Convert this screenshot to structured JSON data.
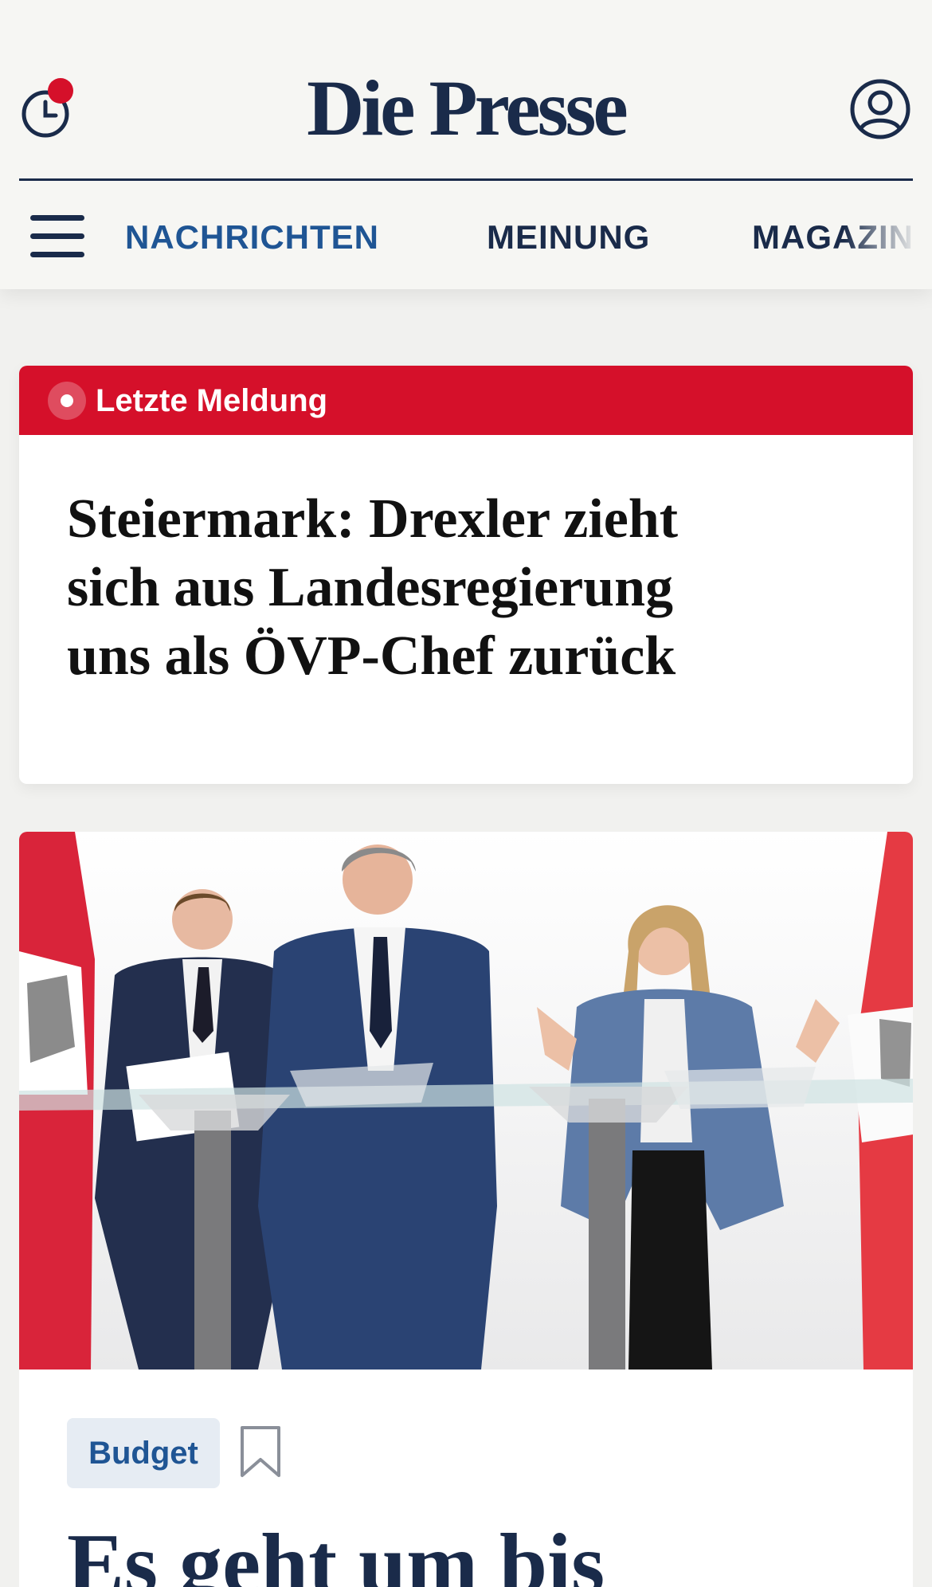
{
  "header": {
    "logo": "Die Presse",
    "nav": {
      "items": [
        {
          "label": "NACHRICHTEN",
          "active": true
        },
        {
          "label": "MEINUNG",
          "active": false
        },
        {
          "label": "MAGAZIN",
          "active": false
        }
      ]
    },
    "icons": {
      "history": "clock-icon",
      "notification": "notification-dot",
      "profile": "user-icon",
      "menu": "hamburger-menu-icon"
    }
  },
  "breaking": {
    "label": "Letzte Meldung",
    "headline": "Steiermark: Drexler zieht sich aus Landesregierung uns als ÖVP-Chef zurück"
  },
  "article": {
    "image_icon": "press-conference-photo",
    "tag": "Budget",
    "bookmark_icon": "bookmark-icon",
    "headline": "Es geht um bis"
  },
  "colors": {
    "brand_navy": "#1a2b4a",
    "nav_active": "#1f5594",
    "breaking_red": "#d5102a",
    "tag_bg": "#e6ecf3",
    "page_bg": "#f1f1ef"
  }
}
